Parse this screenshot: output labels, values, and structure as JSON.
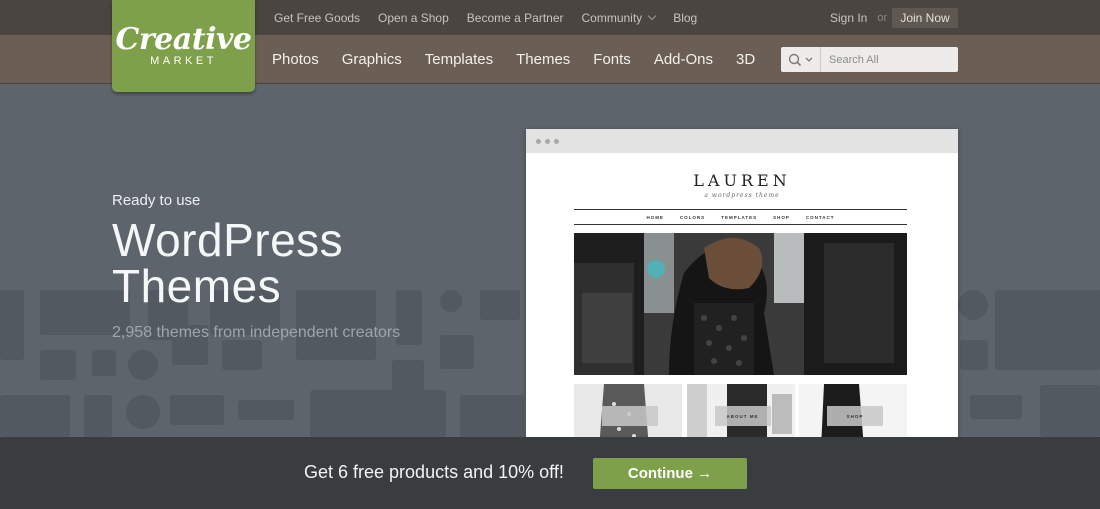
{
  "brand": {
    "logo_script": "Creative",
    "logo_sub": "MARKET"
  },
  "top_links": [
    "Get Free Goods",
    "Open a Shop",
    "Become a Partner",
    "Community",
    "Blog"
  ],
  "auth": {
    "sign_in": "Sign In",
    "or": "or",
    "join": "Join Now"
  },
  "categories": [
    "Photos",
    "Graphics",
    "Templates",
    "Themes",
    "Fonts",
    "Add-Ons",
    "3D"
  ],
  "search": {
    "placeholder": "Search All"
  },
  "hero": {
    "kicker": "Ready to use",
    "title_line1": "WordPress",
    "title_line2": "Themes",
    "subtitle": "2,958 themes from independent creators"
  },
  "preview": {
    "site_title": "LAUREN",
    "tagline": "a wordpress theme",
    "nav": [
      "HOME",
      "COLORS",
      "TEMPLATES",
      "SHOP",
      "CONTACT"
    ],
    "thumb_labels": [
      "",
      "ABOUT ME",
      "SHOP"
    ]
  },
  "promo": {
    "text": "Get 6 free products and 10% off!",
    "button": "Continue →"
  },
  "colors": {
    "accent_green": "#7fa04a",
    "topbar": "#4b4541",
    "catbar": "#6b5f55",
    "hero_bg": "#5d646c",
    "promo_bg": "#3a3d40"
  }
}
